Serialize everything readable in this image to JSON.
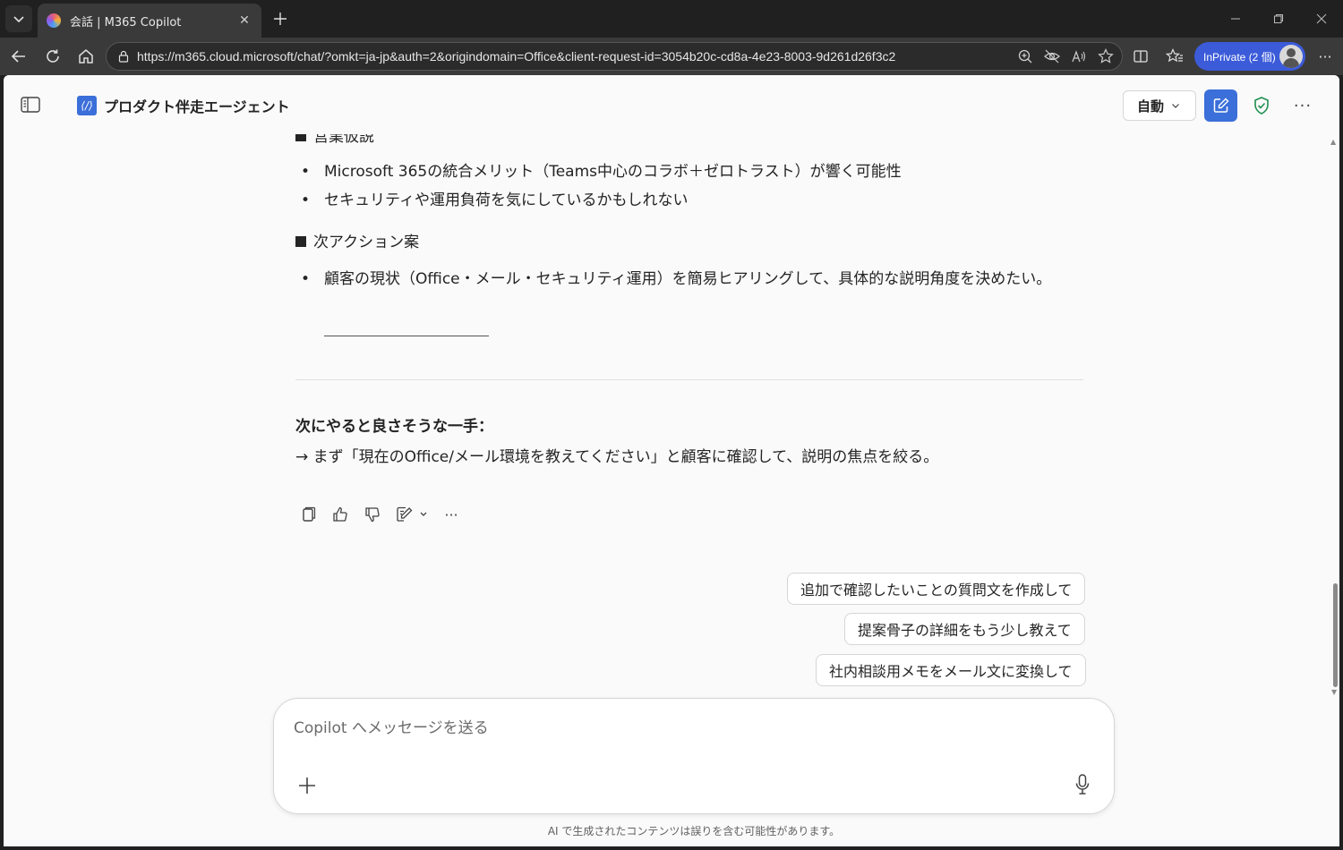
{
  "browser": {
    "tab_title": "会話 | M365 Copilot",
    "url": "https://m365.cloud.microsoft/chat/?omkt=ja-jp&auth=2&origindomain=Office&client-request-id=3054b20c-cd8a-4e23-8003-9d261d26f3c2",
    "inprivate_label": "InPrivate (2 個)"
  },
  "header": {
    "agent_name": "プロダクト伴走エージェント",
    "mode_label": "自動"
  },
  "content": {
    "cut_heading": "営業仮説",
    "bullets_1": [
      "Microsoft 365の統合メリット（Teams中心のコラボ＋ゼロトラスト）が響く可能性",
      "セキュリティや運用負荷を気にしているかもしれない"
    ],
    "heading_2": "次アクション案",
    "bullets_2": [
      "顧客の現状（Office・メール・セキュリティ運用）を簡易ヒアリングして、具体的な説明角度を決めたい。"
    ],
    "next_title": "次にやると良さそうな一手：",
    "next_body": "→ まず「現在のOffice/メール環境を教えてください」と顧客に確認して、説明の焦点を絞る。"
  },
  "suggestions": [
    "追加で確認したいことの質問文を作成して",
    "提案骨子の詳細をもう少し教えて",
    "社内相談用メモをメール文に変換して"
  ],
  "composer": {
    "placeholder": "Copilot へメッセージを送る"
  },
  "footer": {
    "disclaimer": "AI で生成されたコンテンツは誤りを含む可能性があります。"
  },
  "colors": {
    "accent": "#3b6fd9",
    "inprivate": "#3b5bd9",
    "shield": "#1e8f4e"
  }
}
